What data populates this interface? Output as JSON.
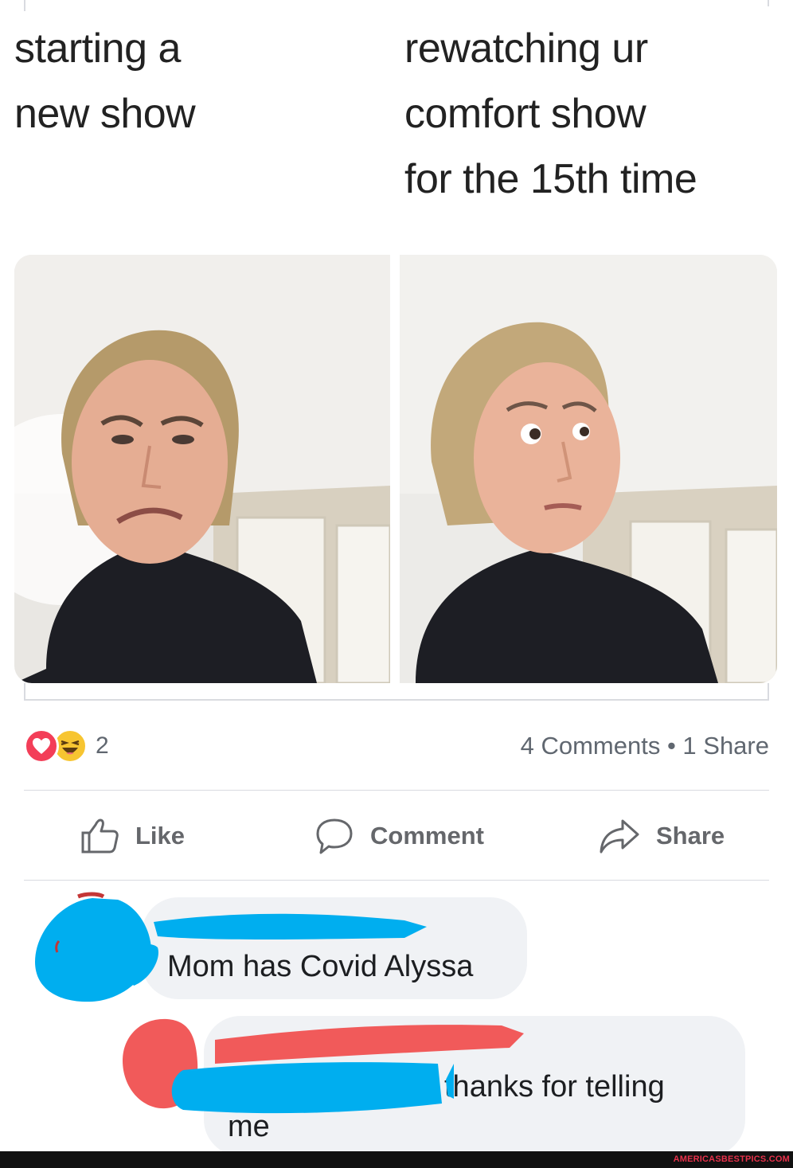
{
  "meme": {
    "left_caption": [
      "starting a",
      "new show"
    ],
    "right_caption": [
      "rewatching ur",
      "comfort show",
      "for the 15th time"
    ]
  },
  "reactions": {
    "types": [
      "heart-icon",
      "haha-icon"
    ],
    "count": "2",
    "comments_share": "4 Comments • 1 Share"
  },
  "actions": {
    "like": "Like",
    "comment": "Comment",
    "share": "Share"
  },
  "comments": [
    {
      "text": "Mom has Covid Alyssa"
    },
    {
      "text_line1": "thanks for telling",
      "text_line2": "me"
    }
  ],
  "colors": {
    "redaction_blue": "#00aeef",
    "redaction_red": "#f15a5a",
    "heart": "#f33e58",
    "haha": "#f7c531",
    "muted_text": "#606770",
    "bubble_bg": "#f0f2f5"
  },
  "watermark": "AMERICASBESTPICS.COM"
}
